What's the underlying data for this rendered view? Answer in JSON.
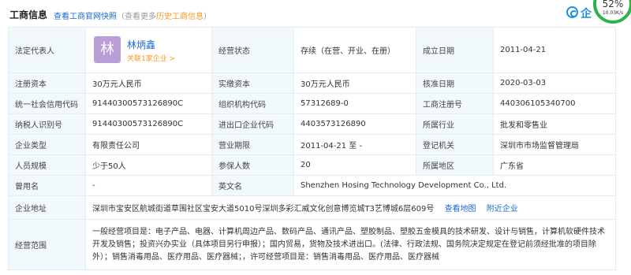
{
  "header": {
    "title": "工商信息",
    "snapshot_link": "查看工商官网快照",
    "hint_prefix": "（查看更多",
    "hint_link": "历史工商信息",
    "hint_suffix": "）",
    "logo_text": "企",
    "speed_percent": "52%",
    "speed_rate": "10.03K/s"
  },
  "colors": {
    "accent": "#1d6ad0",
    "highlight": "#f59a23",
    "label_bg": "#f2f9fc",
    "avatar_bg": "#b99ed8",
    "speed_ring": "#2db34a"
  },
  "rep": {
    "label": "法定代表人",
    "avatar_char": "林",
    "name": "林炳鑫",
    "link": "关联1家企业 >"
  },
  "rows": {
    "status_label": "经营状态",
    "status_value": "存续（在营、开业、在册）",
    "found_label": "成立日期",
    "found_value": "2011-04-21",
    "capital_label": "注册资本",
    "capital_value": "30万元人民币",
    "paid_label": "实缴资本",
    "paid_value": "30万元人民币",
    "approve_label": "核准日期",
    "approve_value": "2020-03-03",
    "credit_label": "统一社会信用代码",
    "credit_value": "91440300573126890C",
    "org_label": "组织机构代码",
    "org_value": "57312689-0",
    "reg_label": "工商注册号",
    "reg_value": "440306105340700",
    "tax_label": "纳税人识别号",
    "tax_value": "91440300573126890C",
    "ie_label": "进出口企业代码",
    "ie_value": "4403573126890",
    "industry_label": "所属行业",
    "industry_value": "批发和零售业",
    "type_label": "企业类型",
    "type_value": "有限责任公司",
    "term_label": "营业期限",
    "term_value": "2011-04-21 至 -",
    "authority_label": "登记机关",
    "authority_value": "深圳市市场监督管理局",
    "staff_label": "人员规模",
    "staff_value": "少于50人",
    "insured_label": "参保人数",
    "insured_value": "20",
    "region_label": "所属地区",
    "region_value": "广东省",
    "former_label": "曾用名",
    "former_value": "-",
    "en_label": "英文名",
    "en_value": "Shenzhen Hosing Technology Development Co., Ltd.",
    "addr_label": "企业地址",
    "addr_value": "深圳市宝安区航城街道草围社区宝安大道5010号深圳多彩汇威文化创意博览城T3艺博城6层609号",
    "addr_map": "查看地图",
    "addr_nearby": "附近企业",
    "scope_label": "经营范围",
    "scope_value": "一般经营项目是：电子产品、电器、计算机周边产品、数码产品、通讯产品、塑胶制品、塑胶五金模具的技术研发、设计与销售，计算机软硬件技术开发及销售；投资兴办实业（具体项目另行申报）；国内贸易，货物及技术进出口。(法律、行政法规、国务院决定规定在登记前须经批准的项目除外）；销售消毒用品、医疗用品、医疗器械；，许可经营项目是：销售消毒用品、医疗用品、医疗器械"
  }
}
